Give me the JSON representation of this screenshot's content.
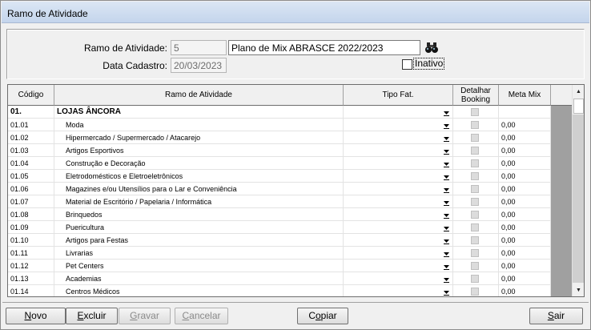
{
  "window": {
    "title": "Ramo de Atividade"
  },
  "form": {
    "ramo_label": "Ramo de Atividade:",
    "ramo_code": "5",
    "ramo_name": "Plano de Mix ABRASCE 2022/2023",
    "data_label": "Data Cadastro:",
    "data_value": "20/03/2023",
    "inativo_label": "Inativo",
    "inativo_checked": false,
    "search_icon": "binoculars-icon"
  },
  "grid": {
    "headers": {
      "codigo": "Código",
      "ramo": "Ramo de Atividade",
      "tipo": "Tipo Fat.",
      "detalhar_1": "Detalhar",
      "detalhar_2": "Booking",
      "meta": "Meta Mix"
    },
    "rows": [
      {
        "code": "01.",
        "name": "LOJAS ÂNCORA",
        "meta": "",
        "group": true
      },
      {
        "code": "01.01",
        "name": "Moda",
        "meta": "0,00"
      },
      {
        "code": "01.02",
        "name": "Hipermercado / Supermercado / Atacarejo",
        "meta": "0,00"
      },
      {
        "code": "01.03",
        "name": "Artigos Esportivos",
        "meta": "0,00"
      },
      {
        "code": "01.04",
        "name": "Construção e Decoração",
        "meta": "0,00"
      },
      {
        "code": "01.05",
        "name": "Eletrodomésticos e Eletroeletrônicos",
        "meta": "0,00"
      },
      {
        "code": "01.06",
        "name": "Magazines e/ou Utensílios para o Lar e Conveniência",
        "meta": "0,00"
      },
      {
        "code": "01.07",
        "name": "Material de Escritório / Papelaria / Informática",
        "meta": "0,00"
      },
      {
        "code": "01.08",
        "name": "Brinquedos",
        "meta": "0,00"
      },
      {
        "code": "01.09",
        "name": "Puericultura",
        "meta": "0,00"
      },
      {
        "code": "01.10",
        "name": "Artigos para Festas",
        "meta": "0,00"
      },
      {
        "code": "01.11",
        "name": "Livrarias",
        "meta": "0,00"
      },
      {
        "code": "01.12",
        "name": "Pet Centers",
        "meta": "0,00"
      },
      {
        "code": "01.13",
        "name": "Academias",
        "meta": "0,00"
      },
      {
        "code": "01.14",
        "name": "Centros Médicos",
        "meta": "0,00"
      }
    ]
  },
  "buttons": {
    "novo": {
      "hot": "N",
      "rest": "ovo"
    },
    "excluir": {
      "hot": "E",
      "rest": "xcluir"
    },
    "gravar": {
      "hot": "G",
      "rest": "ravar"
    },
    "cancelar": {
      "hot": "C",
      "rest": "ancelar"
    },
    "copiar": {
      "pre": "C",
      "hot": "o",
      "rest": "piar"
    },
    "sair": {
      "hot": "S",
      "rest": "air"
    }
  }
}
